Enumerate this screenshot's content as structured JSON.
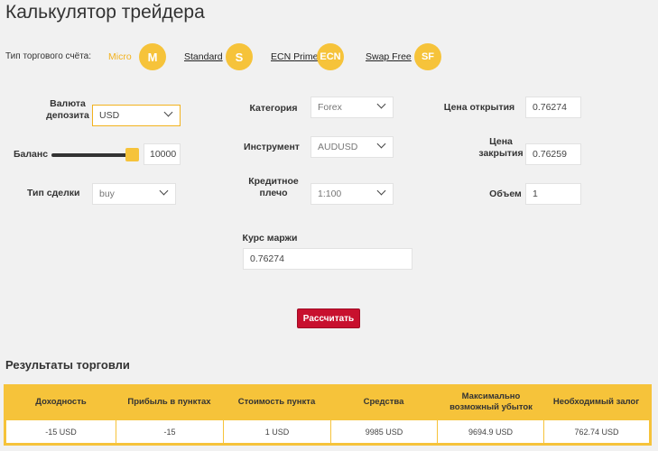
{
  "page": {
    "title": "Калькулятор трейдера"
  },
  "account_types": {
    "label": "Тип торгового счёта:",
    "items": [
      {
        "name": "Micro",
        "badge": "M",
        "active": true
      },
      {
        "name": "Standard",
        "badge": "S",
        "active": false
      },
      {
        "name": "ECN Prime",
        "badge": "ECN",
        "active": false
      },
      {
        "name": "Swap Free",
        "badge": "SF",
        "active": false
      }
    ]
  },
  "form": {
    "deposit_currency": {
      "label_line1": "Валюта",
      "label_line2": "депозита",
      "value": "USD"
    },
    "balance": {
      "label": "Баланс",
      "value": "10000",
      "level": 1.0
    },
    "trade_type": {
      "label": "Тип сделки",
      "value": "buy"
    },
    "category": {
      "label": "Категория",
      "value": "Forex"
    },
    "instrument": {
      "label": "Инструмент",
      "value": "AUDUSD"
    },
    "leverage": {
      "label_line1": "Кредитное",
      "label_line2": "плечо",
      "value": "1:100"
    },
    "open_price": {
      "label": "Цена открытия",
      "value": "0.76274"
    },
    "close_price": {
      "label_line1": "Цена",
      "label_line2": "закрытия",
      "value": "0.76259"
    },
    "volume": {
      "label": "Объем",
      "value": "1"
    },
    "margin_rate": {
      "label": "Курс маржи",
      "value": "0.76274"
    },
    "calculate_label": "Рассчитать"
  },
  "results": {
    "title": "Результаты торговли",
    "columns": [
      "Доходность",
      "Прибыль в пунктах",
      "Стоимость пункта",
      "Средства",
      "Максимально возможный убыток",
      "Необходимый залог"
    ],
    "row": [
      "-15 USD",
      "-15",
      "1 USD",
      "9985 USD",
      "9694.9 USD",
      "762.74 USD"
    ]
  },
  "colors": {
    "accent": "#f6c33a",
    "button": "#c8102e",
    "background": "#f1f1f1"
  }
}
